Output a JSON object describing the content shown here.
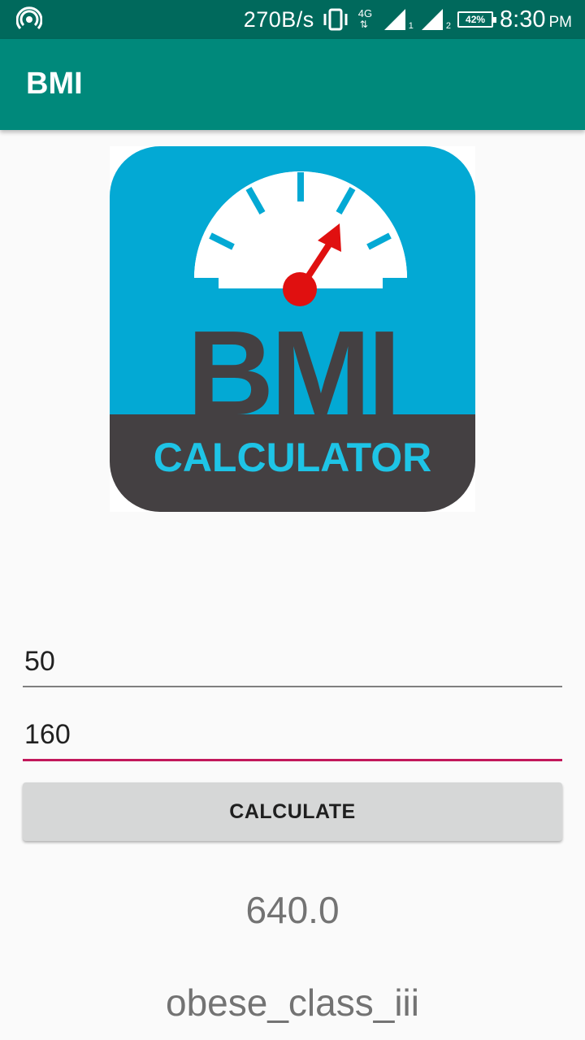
{
  "status_bar": {
    "net_speed": "270B/s",
    "network_type": "4G",
    "sim1_label": "1",
    "sim2_label": "2",
    "battery": "42%",
    "time": "8:30",
    "ampm": "PM",
    "icons": [
      "hotspot-icon",
      "vibrate-icon",
      "data-arrows-icon",
      "signal-icon",
      "signal-icon",
      "battery-icon"
    ]
  },
  "app_bar": {
    "title": "BMI",
    "color": "#00897b",
    "status_color": "#00695c"
  },
  "logo": {
    "word1": "BMI",
    "word2": "CALCULATOR",
    "bg_color": "#03a9d4",
    "dark_color": "#444042",
    "needle_color": "#e01010"
  },
  "form": {
    "weight_value": "50",
    "height_value": "160",
    "accent_color": "#c2185b"
  },
  "calculate_button": {
    "label": "CALCULATE"
  },
  "result": {
    "value": "640.0",
    "category": "obese_class_iii"
  }
}
